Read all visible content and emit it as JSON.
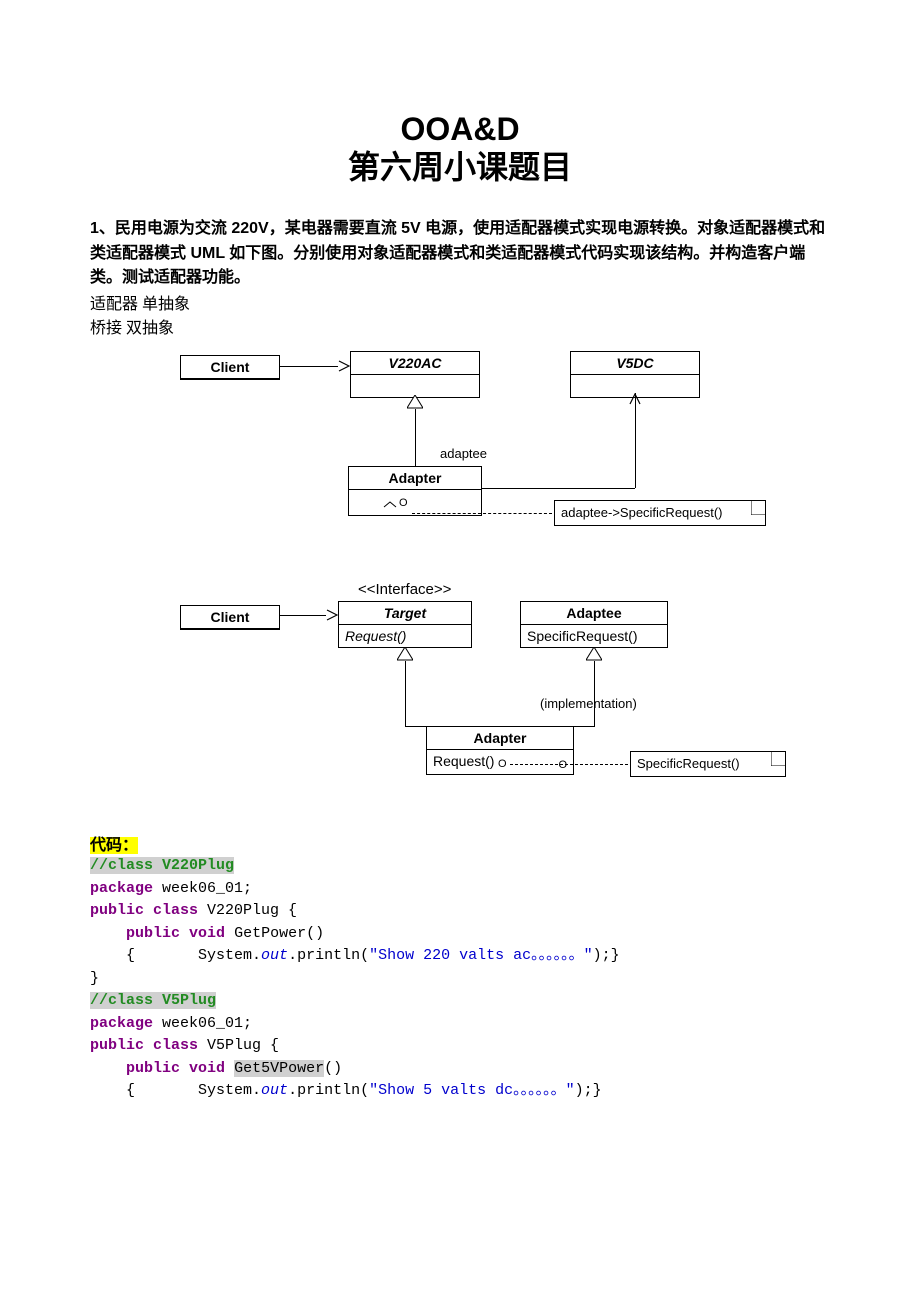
{
  "title": {
    "line1": "OOA&D",
    "line2": "第六周小课题目"
  },
  "question": "1、民用电源为交流 220V，某电器需要直流 5V 电源，使用适配器模式实现电源转换。对象适配器模式和类适配器模式 UML 如下图。分别使用对象适配器模式和类适配器模式代码实现该结构。并构造客户端类。测试适配器功能。",
  "notes": {
    "l1": "适配器  单抽象",
    "l2": "桥接   双抽象"
  },
  "diagram1": {
    "client": "Client",
    "v220": "V220AC",
    "v5": "V5DC",
    "adapter": "Adapter",
    "adaptee_lbl": "adaptee",
    "note": "adaptee->SpecificRequest()"
  },
  "diagram2": {
    "client": "Client",
    "interface_tag": "<<Interface>>",
    "target": "Target",
    "target_m": "Request()",
    "adaptee": "Adaptee",
    "adaptee_m": "SpecificRequest()",
    "impl_lbl": "(implementation)",
    "adapter": "Adapter",
    "adapter_m": "Request()",
    "note": "SpecificRequest()"
  },
  "code_label": "代码：",
  "code": {
    "c1_comment": "//class V220Plug",
    "pkg": "package",
    "pkg_name": " week06_01;",
    "pub": "public",
    "cls": "class",
    "void": "void",
    "c1_name": " V220Plug {",
    "c1_method": " GetPower()",
    "sys": "System.",
    "out": "out",
    "println": ".println(",
    "c1_str": "\"Show 220 valts ac。。。。。。\"",
    "c1_end": ");}",
    "close": "}",
    "c2_comment": "//class V5Plug",
    "c2_name": " V5Plug {",
    "c2_method": "Get5VPower",
    "c2_paren": "()",
    "c2_str": "\"Show 5 valts dc。。。。。。\"",
    "c2_end": ");}"
  }
}
